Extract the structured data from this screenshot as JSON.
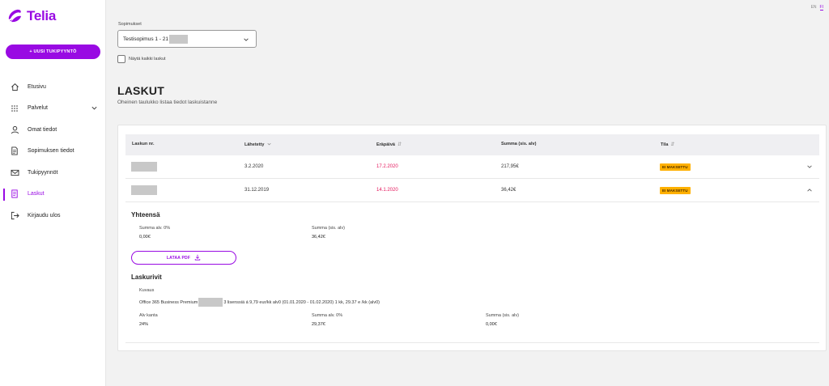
{
  "brand": {
    "name": "Telia",
    "color": "#990ae3"
  },
  "lang": {
    "en": "EN",
    "fi": "FI"
  },
  "sidebar": {
    "new_ticket_label": "+ UUSI TUKIPYYNTÖ",
    "items": [
      {
        "label": "Etusivu",
        "icon": "home-icon"
      },
      {
        "label": "Palvelut",
        "icon": "grid-icon"
      },
      {
        "label": "Omat tiedot",
        "icon": "user-icon"
      },
      {
        "label": "Sopimuksen tiedot",
        "icon": "document-icon"
      },
      {
        "label": "Tukipyynnöt",
        "icon": "mail-icon"
      },
      {
        "label": "Laskut",
        "icon": "invoice-icon",
        "active": true
      },
      {
        "label": "Kirjaudu ulos",
        "icon": "logout-icon"
      }
    ]
  },
  "contract": {
    "label": "Sopimukset",
    "selected": "Testisopimus 1 - 21",
    "show_all_label": "Näytä kaikki laskut"
  },
  "page": {
    "title": "LASKUT",
    "subtitle": "Oheinen taulukko listaa tiedot laskuistanne"
  },
  "table": {
    "headers": {
      "number": "Laskun nr.",
      "sent": "Lähetetty",
      "due": "Eräpäivä",
      "sum": "Summa (sis. alv)",
      "status": "Tila"
    },
    "rows": [
      {
        "sent": "3.2.2020",
        "due": "17.2.2020",
        "sum": "217,95€",
        "status": "EI MAKSETTU"
      },
      {
        "sent": "31.12.2019",
        "due": "14.1.2020",
        "sum": "36,42€",
        "status": "EI MAKSETTU"
      }
    ]
  },
  "details": {
    "total_title": "Yhteensä",
    "sum_vat0_label": "Summa alv. 0%",
    "sum_vat0_value": "0,00€",
    "sum_incl_label": "Summa (sis. alv)",
    "sum_incl_value": "36,42€",
    "pdf_label": "LATAA PDF",
    "lines_title": "Laskurivit",
    "desc_label": "Kuvaus",
    "desc_prefix": "Office 365 Business Premium",
    "desc_suffix": "3 lisenssiä á 9,79 eur/kk alv0 (01.01.2020 - 01.02.2020) 1 kk, 29.37 e /kk (alv0)",
    "vat_rate_label": "Alv kanta",
    "vat_rate_value": "24%",
    "line_vat0_label": "Summa alv. 0%",
    "line_vat0_value": "29,37€",
    "line_incl_label": "Summa (sis. alv)",
    "line_incl_value": "0,00€"
  }
}
